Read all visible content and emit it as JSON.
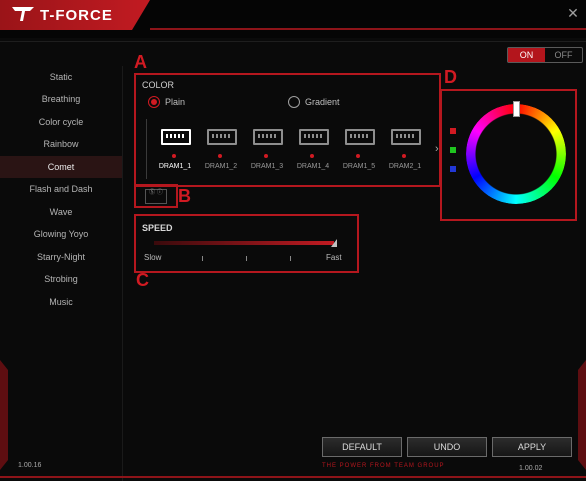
{
  "header": {
    "logo_text": "T-FORCE",
    "close_symbol": "✕"
  },
  "power_toggle": {
    "on_label": "ON",
    "off_label": "OFF",
    "state": "on"
  },
  "sidebar": {
    "items": [
      {
        "label": "Static",
        "active": false
      },
      {
        "label": "Breathing",
        "active": false
      },
      {
        "label": "Color cycle",
        "active": false
      },
      {
        "label": "Rainbow",
        "active": false
      },
      {
        "label": "Comet",
        "active": true
      },
      {
        "label": "Flash and Dash",
        "active": false
      },
      {
        "label": "Wave",
        "active": false
      },
      {
        "label": "Glowing Yoyo",
        "active": false
      },
      {
        "label": "Starry-Night",
        "active": false
      },
      {
        "label": "Strobing",
        "active": false
      },
      {
        "label": "Music",
        "active": false
      }
    ]
  },
  "annotations": {
    "a": "A",
    "b": "B",
    "c": "C",
    "d": "D"
  },
  "color_panel": {
    "title": "COLOR",
    "options": [
      {
        "label": "Plain",
        "selected": true
      },
      {
        "label": "Gradient",
        "selected": false
      }
    ],
    "modules": [
      {
        "label": "DRAM1_1",
        "active": true
      },
      {
        "label": "DRAM1_2",
        "active": false
      },
      {
        "label": "DRAM1_3",
        "active": false
      },
      {
        "label": "DRAM1_4",
        "active": false
      },
      {
        "label": "DRAM1_5",
        "active": false
      },
      {
        "label": "DRAM2_1",
        "active": false
      }
    ],
    "next_symbol": "›"
  },
  "sync_button": {
    "text": "Ⓢ ⓘ"
  },
  "speed_panel": {
    "title": "SPEED",
    "min_label": "Slow",
    "max_label": "Fast",
    "level": 1.0,
    "ticks": 3
  },
  "color_picker": {
    "swatches": [
      {
        "name": "red",
        "color": "#d11a22"
      },
      {
        "name": "green",
        "color": "#1fc51f"
      },
      {
        "name": "blue",
        "color": "#2238d6"
      }
    ]
  },
  "buttons": {
    "default": "DEFAULT",
    "undo": "UNDO",
    "apply": "APPLY"
  },
  "footer": {
    "tagline": "THE POWER FROM TEAM GROUP",
    "version_left": "1.00.16",
    "version_right": "1.00.02"
  },
  "colors": {
    "accent": "#b5171e",
    "background": "#0a0a0a"
  }
}
